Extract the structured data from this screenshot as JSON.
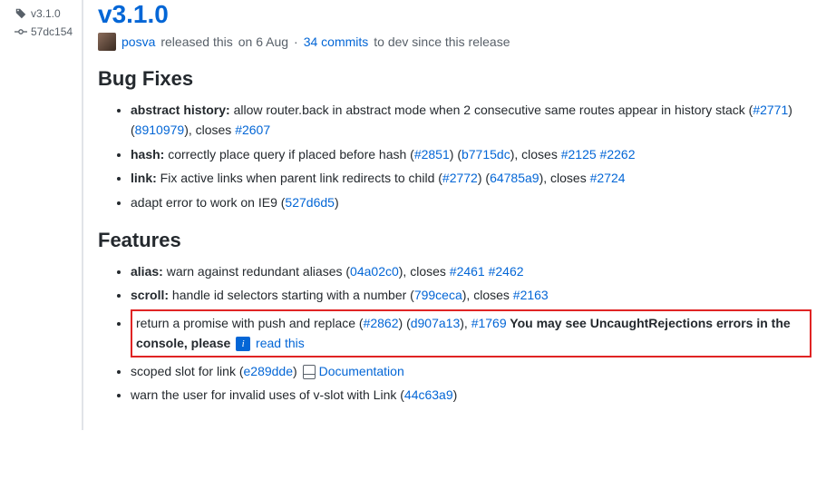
{
  "sidebar": {
    "version": "v3.1.0",
    "commit_short": "57dc154"
  },
  "release": {
    "title": "v3.1.0",
    "author": "posva",
    "released_verb": "released this",
    "released_date": "on 6 Aug",
    "commits_link": "34 commits",
    "commits_suffix": "to dev since this release"
  },
  "sections": {
    "bugfixes": {
      "heading": "Bug Fixes",
      "items": [
        {
          "scope": "abstract history:",
          "text_a": " allow router.back in abstract mode when 2 consecutive same routes appear in history stack (",
          "link1": "#2771",
          "mid1": ") (",
          "link2": "8910979",
          "mid2": "), closes ",
          "link3": "#2607"
        },
        {
          "scope": "hash:",
          "text_a": " correctly place query if placed before hash (",
          "link1": "#2851",
          "mid1": ") (",
          "link2": "b7715dc",
          "mid2": "), closes ",
          "link3": "#2125",
          "sp": " ",
          "link4": "#2262"
        },
        {
          "scope": "link:",
          "text_a": " Fix active links when parent link redirects to child (",
          "link1": "#2772",
          "mid1": ") (",
          "link2": "64785a9",
          "mid2": "), closes ",
          "link3": "#2724"
        },
        {
          "text_a": "adapt error to work on IE9 (",
          "link1": "527d6d5",
          "mid1": ")"
        }
      ]
    },
    "features": {
      "heading": "Features",
      "items": [
        {
          "scope": "alias:",
          "text_a": " warn against redundant aliases (",
          "link1": "04a02c0",
          "mid1": "), closes ",
          "link2": "#2461",
          "sp": " ",
          "link3": "#2462"
        },
        {
          "scope": "scroll:",
          "text_a": " handle id selectors starting with a number (",
          "link1": "799ceca",
          "mid1": "), closes ",
          "link2": "#2163"
        },
        {
          "highlight": true,
          "text_a": "return a promise with push and replace (",
          "link1": "#2862",
          "mid1": ") (",
          "link2": "d907a13",
          "mid2": "), ",
          "link3": "#1769",
          "bold": " You may see UncaughtRejections errors in the console, please ",
          "badge": "i",
          "link4": " read this"
        },
        {
          "text_a": "scoped slot for link (",
          "link1": "e289dde",
          "mid1": ") ",
          "doc_icon": true,
          "link2": "Documentation"
        },
        {
          "text_a": "warn the user for invalid uses of v-slot with Link (",
          "link1": "44c63a9",
          "mid1": ")"
        }
      ]
    }
  }
}
